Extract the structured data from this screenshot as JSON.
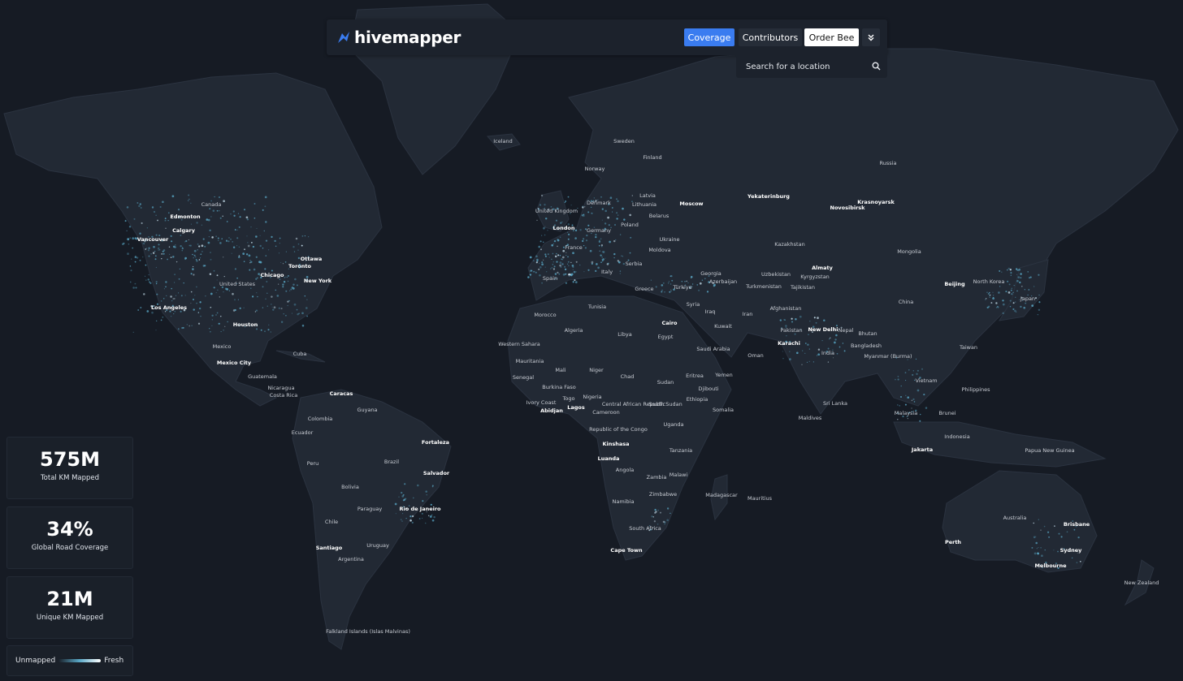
{
  "brand": {
    "name": "hivemapper"
  },
  "nav": {
    "coverage": "Coverage",
    "contributors": "Contributors",
    "order": "Order Bee",
    "more_icon": "chevron-double-down-icon"
  },
  "search": {
    "placeholder": "Search for a location"
  },
  "stats": [
    {
      "value": "575M",
      "label": "Total KM Mapped"
    },
    {
      "value": "34%",
      "label": "Global Road Coverage"
    },
    {
      "value": "21M",
      "label": "Unique KM Mapped"
    }
  ],
  "legend": {
    "left": "Unmapped",
    "right": "Fresh"
  },
  "colors": {
    "accent": "#3a7cf0",
    "coverage": "#5aa9c8",
    "land": "#222934",
    "water": "#161b24"
  },
  "places": [
    {
      "name": "Iceland",
      "bold": false
    },
    {
      "name": "Sweden",
      "bold": false
    },
    {
      "name": "Finland",
      "bold": false
    },
    {
      "name": "Norway",
      "bold": false
    },
    {
      "name": "Russia",
      "bold": false
    },
    {
      "name": "Denmark",
      "bold": false
    },
    {
      "name": "Latvia",
      "bold": false
    },
    {
      "name": "Lithuania",
      "bold": false
    },
    {
      "name": "Moscow",
      "bold": true
    },
    {
      "name": "Yekaterinburg",
      "bold": true
    },
    {
      "name": "Novosibirsk",
      "bold": true
    },
    {
      "name": "Krasnoyarsk",
      "bold": true
    },
    {
      "name": "United Kingdom",
      "bold": false
    },
    {
      "name": "London",
      "bold": true
    },
    {
      "name": "Belarus",
      "bold": false
    },
    {
      "name": "Poland",
      "bold": false
    },
    {
      "name": "Germany",
      "bold": false
    },
    {
      "name": "Ukraine",
      "bold": false
    },
    {
      "name": "Kazakhstan",
      "bold": false
    },
    {
      "name": "Mongolia",
      "bold": false
    },
    {
      "name": "France",
      "bold": false
    },
    {
      "name": "Moldova",
      "bold": false
    },
    {
      "name": "Serbia",
      "bold": false
    },
    {
      "name": "Italy",
      "bold": false
    },
    {
      "name": "Georgia",
      "bold": false
    },
    {
      "name": "Azerbaijan",
      "bold": false
    },
    {
      "name": "Uzbekistan",
      "bold": false
    },
    {
      "name": "Almaty",
      "bold": true
    },
    {
      "name": "Kyrgyzstan",
      "bold": false
    },
    {
      "name": "Spain",
      "bold": false
    },
    {
      "name": "Greece",
      "bold": false
    },
    {
      "name": "Türkiye",
      "bold": false
    },
    {
      "name": "Turkmenistan",
      "bold": false
    },
    {
      "name": "Tajikistan",
      "bold": false
    },
    {
      "name": "Beijing",
      "bold": true
    },
    {
      "name": "North Korea",
      "bold": false
    },
    {
      "name": "Japan",
      "bold": false
    },
    {
      "name": "China",
      "bold": false
    },
    {
      "name": "Morocco",
      "bold": false
    },
    {
      "name": "Tunisia",
      "bold": false
    },
    {
      "name": "Syria",
      "bold": false
    },
    {
      "name": "Iraq",
      "bold": false
    },
    {
      "name": "Iran",
      "bold": false
    },
    {
      "name": "Afghanistan",
      "bold": false
    },
    {
      "name": "Cairo",
      "bold": true
    },
    {
      "name": "Algeria",
      "bold": false
    },
    {
      "name": "Libya",
      "bold": false
    },
    {
      "name": "Egypt",
      "bold": false
    },
    {
      "name": "Kuwait",
      "bold": false
    },
    {
      "name": "Pakistan",
      "bold": false
    },
    {
      "name": "New Delhi",
      "bold": true
    },
    {
      "name": "Nepal",
      "bold": false
    },
    {
      "name": "Bhutan",
      "bold": false
    },
    {
      "name": "Western Sahara",
      "bold": false
    },
    {
      "name": "Saudi Arabia",
      "bold": false
    },
    {
      "name": "Karachi",
      "bold": true
    },
    {
      "name": "India",
      "bold": false
    },
    {
      "name": "Bangladesh",
      "bold": false
    },
    {
      "name": "Taiwan",
      "bold": false
    },
    {
      "name": "Mauritania",
      "bold": false
    },
    {
      "name": "Oman",
      "bold": false
    },
    {
      "name": "Myanmar (Burma)",
      "bold": false
    },
    {
      "name": "Mali",
      "bold": false
    },
    {
      "name": "Niger",
      "bold": false
    },
    {
      "name": "Senegal",
      "bold": false
    },
    {
      "name": "Chad",
      "bold": false
    },
    {
      "name": "Sudan",
      "bold": false
    },
    {
      "name": "Eritrea",
      "bold": false
    },
    {
      "name": "Yemen",
      "bold": false
    },
    {
      "name": "Vietnam",
      "bold": false
    },
    {
      "name": "Burkina Faso",
      "bold": false
    },
    {
      "name": "Djibouti",
      "bold": false
    },
    {
      "name": "Philippines",
      "bold": false
    },
    {
      "name": "Ivory Coast",
      "bold": false
    },
    {
      "name": "Togo",
      "bold": false
    },
    {
      "name": "Nigeria",
      "bold": false
    },
    {
      "name": "Ethiopia",
      "bold": false
    },
    {
      "name": "Sri Lanka",
      "bold": false
    },
    {
      "name": "Abidjan",
      "bold": true
    },
    {
      "name": "Lagos",
      "bold": true
    },
    {
      "name": "Central African Republic",
      "bold": false
    },
    {
      "name": "South Sudan",
      "bold": false
    },
    {
      "name": "Somalia",
      "bold": false
    },
    {
      "name": "Cameroon",
      "bold": false
    },
    {
      "name": "Maldives",
      "bold": false
    },
    {
      "name": "Malaysia",
      "bold": false
    },
    {
      "name": "Brunei",
      "bold": false
    },
    {
      "name": "Uganda",
      "bold": false
    },
    {
      "name": "Republic of the Congo",
      "bold": false
    },
    {
      "name": "Indonesia",
      "bold": false
    },
    {
      "name": "Kinshasa",
      "bold": true
    },
    {
      "name": "Tanzania",
      "bold": false
    },
    {
      "name": "Jakarta",
      "bold": true
    },
    {
      "name": "Papua New Guinea",
      "bold": false
    },
    {
      "name": "Luanda",
      "bold": true
    },
    {
      "name": "Angola",
      "bold": false
    },
    {
      "name": "Malawi",
      "bold": false
    },
    {
      "name": "Zambia",
      "bold": false
    },
    {
      "name": "Zimbabwe",
      "bold": false
    },
    {
      "name": "Madagascar",
      "bold": false
    },
    {
      "name": "Mauritius",
      "bold": false
    },
    {
      "name": "Namibia",
      "bold": false
    },
    {
      "name": "Australia",
      "bold": false
    },
    {
      "name": "South Africa",
      "bold": false
    },
    {
      "name": "Brisbane",
      "bold": true
    },
    {
      "name": "Perth",
      "bold": true
    },
    {
      "name": "Cape Town",
      "bold": true
    },
    {
      "name": "Sydney",
      "bold": true
    },
    {
      "name": "Melbourne",
      "bold": true
    },
    {
      "name": "New Zealand",
      "bold": false
    },
    {
      "name": "Canada",
      "bold": false
    },
    {
      "name": "Edmonton",
      "bold": true
    },
    {
      "name": "Calgary",
      "bold": true
    },
    {
      "name": "Vancouver",
      "bold": true
    },
    {
      "name": "Ottawa",
      "bold": true
    },
    {
      "name": "Toronto",
      "bold": true
    },
    {
      "name": "Chicago",
      "bold": true
    },
    {
      "name": "New York",
      "bold": true
    },
    {
      "name": "United States",
      "bold": false
    },
    {
      "name": "Los Angeles",
      "bold": true
    },
    {
      "name": "Houston",
      "bold": true
    },
    {
      "name": "Mexico",
      "bold": false
    },
    {
      "name": "Cuba",
      "bold": false
    },
    {
      "name": "Mexico City",
      "bold": true
    },
    {
      "name": "Guatemala",
      "bold": false
    },
    {
      "name": "Nicaragua",
      "bold": false
    },
    {
      "name": "Costa Rica",
      "bold": false
    },
    {
      "name": "Caracas",
      "bold": true
    },
    {
      "name": "Guyana",
      "bold": false
    },
    {
      "name": "Colombia",
      "bold": false
    },
    {
      "name": "Ecuador",
      "bold": false
    },
    {
      "name": "Fortaleza",
      "bold": true
    },
    {
      "name": "Brazil",
      "bold": false
    },
    {
      "name": "Peru",
      "bold": false
    },
    {
      "name": "Salvador",
      "bold": true
    },
    {
      "name": "Bolivia",
      "bold": false
    },
    {
      "name": "Rio de Janeiro",
      "bold": true
    },
    {
      "name": "Paraguay",
      "bold": false
    },
    {
      "name": "Chile",
      "bold": false
    },
    {
      "name": "Santiago",
      "bold": true
    },
    {
      "name": "Uruguay",
      "bold": false
    },
    {
      "name": "Argentina",
      "bold": false
    },
    {
      "name": "Falkland Islands (Islas Malvinas)",
      "bold": false
    }
  ]
}
